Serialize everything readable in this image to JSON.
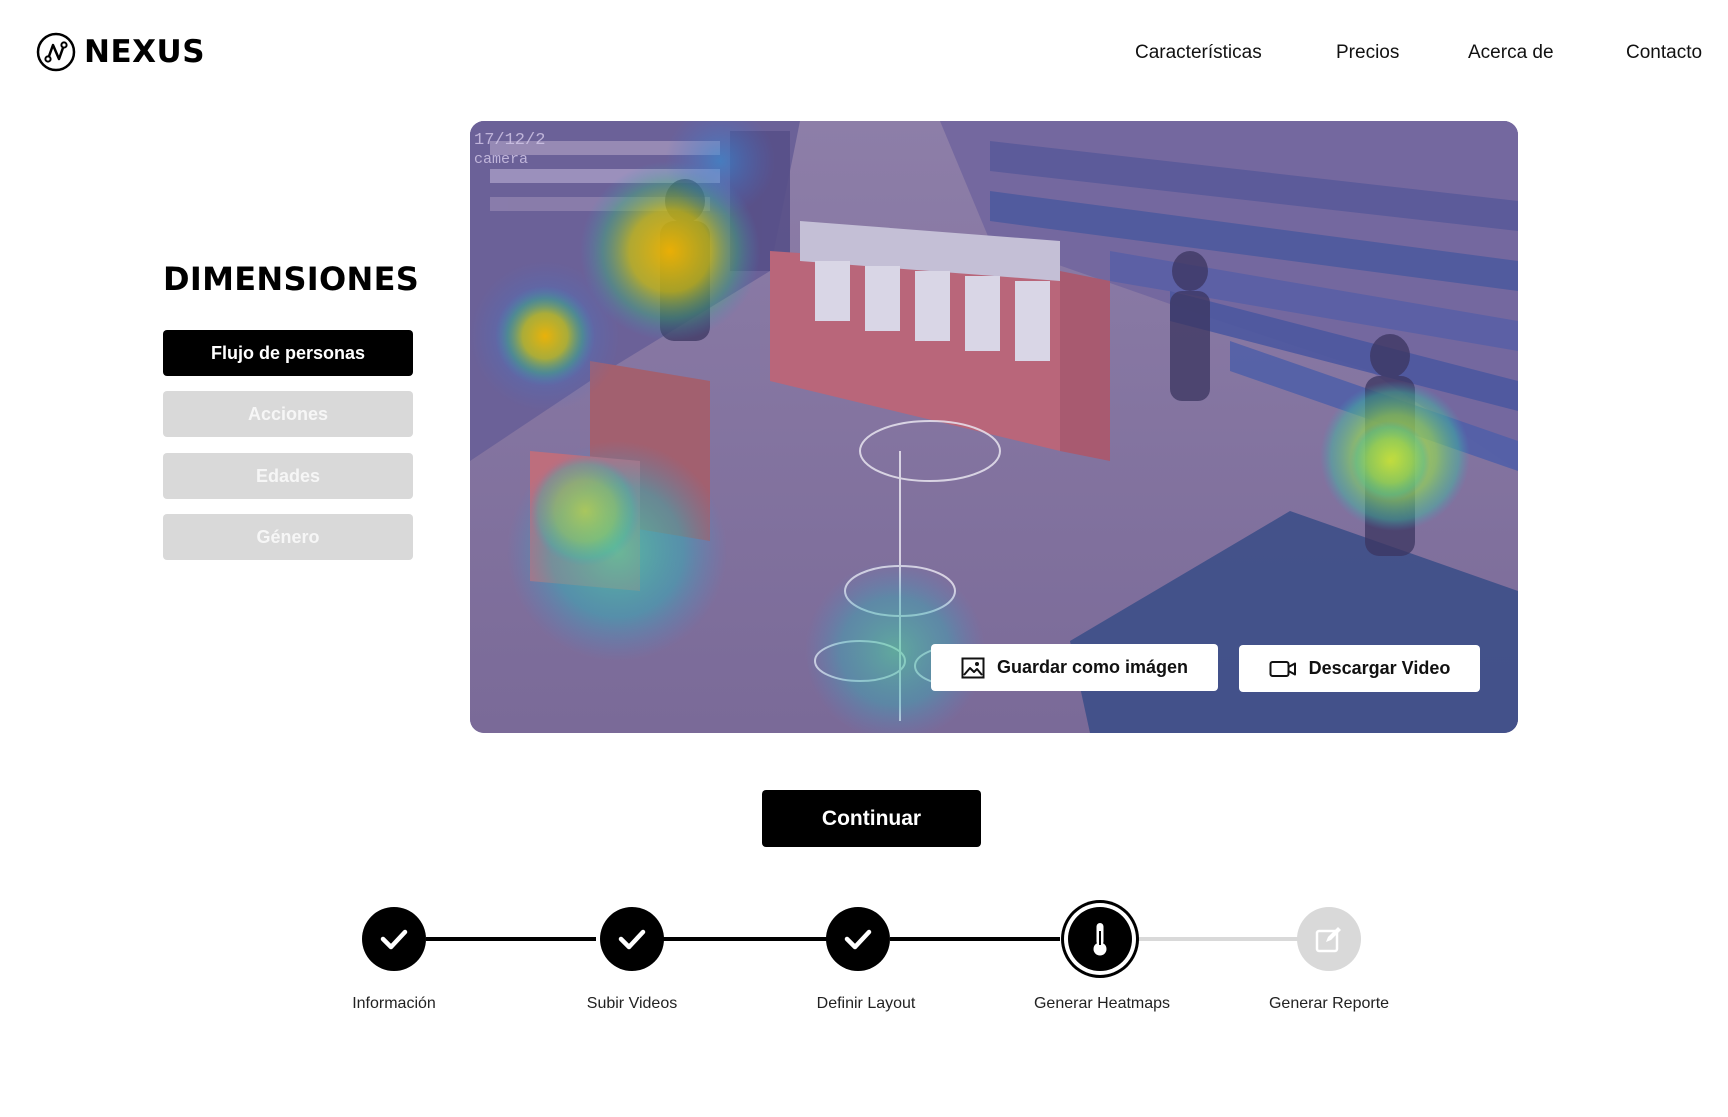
{
  "header": {
    "brand": "NEXUS",
    "nav": [
      "Características",
      "Precios",
      "Acerca de",
      "Contacto"
    ]
  },
  "sidebar": {
    "title": "DIMENSIONES",
    "items": [
      {
        "label": "Flujo de personas",
        "active": true
      },
      {
        "label": "Acciones",
        "active": false
      },
      {
        "label": "Edades",
        "active": false
      },
      {
        "label": "Género",
        "active": false
      }
    ]
  },
  "video": {
    "timestamp": "17/12/2",
    "camera_label": "camera",
    "save_image_label": "Guardar como imágen",
    "download_video_label": "Descargar Video"
  },
  "continue_label": "Continuar",
  "steps": [
    {
      "label": "Información",
      "status": "done",
      "icon": "check-icon"
    },
    {
      "label": "Subir Videos",
      "status": "done",
      "icon": "check-icon"
    },
    {
      "label": "Definir Layout",
      "status": "done",
      "icon": "check-icon"
    },
    {
      "label": "Generar Heatmaps",
      "status": "current",
      "icon": "thermometer-icon"
    },
    {
      "label": "Generar Reporte",
      "status": "todo",
      "icon": "edit-icon"
    }
  ],
  "colors": {
    "primary": "#000000",
    "inactive": "#d9d9d9",
    "overlay": "#6f6aa0"
  }
}
